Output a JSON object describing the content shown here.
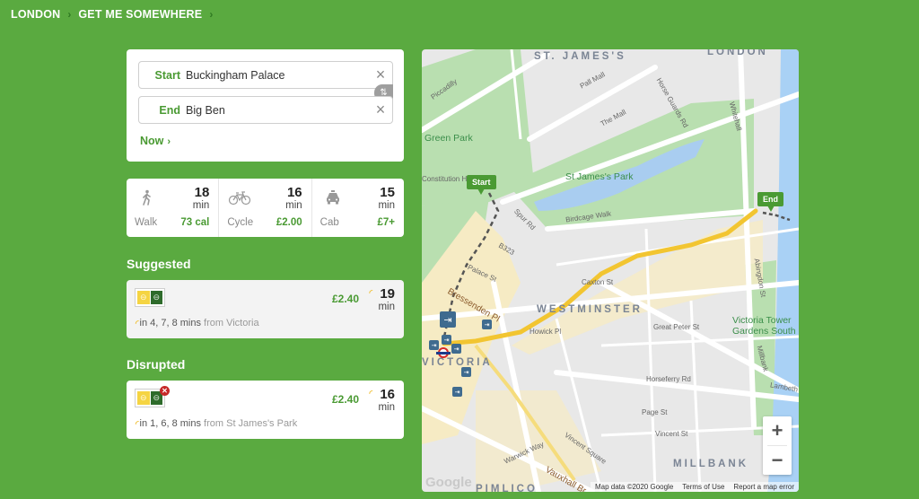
{
  "breadcrumb": [
    {
      "label": "LONDON"
    },
    {
      "label": "GET ME SOMEWHERE"
    }
  ],
  "route": {
    "start_label": "Start",
    "start_value": "Buckingham Palace",
    "end_label": "End",
    "end_value": "Big Ben",
    "clear_icon": "×",
    "swap_icon": "⇅",
    "time_label": "Now",
    "time_chevron": "›"
  },
  "modes": [
    {
      "icon": "walk-icon",
      "name": "Walk",
      "time": "18",
      "unit": "min",
      "extra": "73 cal"
    },
    {
      "icon": "bicycle-icon",
      "name": "Cycle",
      "time": "16",
      "unit": "min",
      "extra": "£2.00"
    },
    {
      "icon": "taxi-icon",
      "name": "Cab",
      "time": "15",
      "unit": "min",
      "extra": "£7+"
    }
  ],
  "suggested": {
    "heading": "Suggested",
    "journey": {
      "lines": [
        "Circle",
        "District"
      ],
      "price": "£2.40",
      "time": "19",
      "unit": "min",
      "next": "in 4, 7, 8 mins",
      "from": "from Victoria",
      "disrupted": false
    }
  },
  "disrupted": {
    "heading": "Disrupted",
    "journey": {
      "lines": [
        "Circle",
        "District"
      ],
      "price": "£2.40",
      "time": "16",
      "unit": "min",
      "next": "in 1, 6, 8 mins",
      "from": "from St James's Park",
      "disrupted": true
    }
  },
  "map": {
    "start_pin": "Start",
    "end_pin": "End",
    "labels": {
      "st_james": "ST. JAMES'S",
      "london": "LONDON",
      "green_park": "Green Park",
      "st_james_park": "St James's Park",
      "westminster": "WESTMINSTER",
      "victoria": "VICTORIA",
      "victoria_tower": "Victoria Tower",
      "gardens_south": "Gardens South",
      "millbank": "MILLBANK",
      "pimlico": "PIMLICO",
      "piccadilly": "Piccadilly",
      "pall_mall": "Pall Mall",
      "the_mall": "The Mall",
      "horse_guards": "Horse Guards Rd",
      "whitehall": "Whitehall",
      "birdcage": "Birdcage Walk",
      "spur_rd": "Spur Rd",
      "b323": "B323",
      "bressenden": "Bressenden Pl",
      "caxton": "Caxton St",
      "howick": "Howick Pl",
      "great_peter": "Great Peter St",
      "horseferry": "Horseferry Rd",
      "page_st": "Page St",
      "vincent_st": "Vincent St",
      "lambeth": "Lambeth",
      "abingdon": "Abingdon St",
      "millbank_st": "Millbank",
      "vauxhall": "Vauxhall Br",
      "vincent_sq": "Vincent Square",
      "warwick": "Warwick Way",
      "constitution": "Constitution Hill",
      "palace_st": "Palace St"
    },
    "zoom_in": "+",
    "zoom_out": "−",
    "google": "Google",
    "footer": {
      "map_data": "Map data ©2020 Google",
      "terms": "Terms of Use",
      "report": "Report a map error"
    }
  },
  "colors": {
    "brand_green": "#5aaa40",
    "accent_green": "#4a9a33",
    "circle_line": "#f5d442",
    "district_line": "#2e6b2b",
    "route_line": "#f2c531",
    "disruption_red": "#c62828"
  }
}
